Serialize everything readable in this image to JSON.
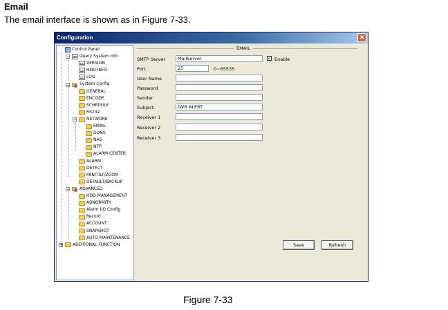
{
  "doc": {
    "heading": "Email",
    "intro": "The email interface is shown as in Figure 7-33.",
    "caption": "Figure 7-33"
  },
  "window": {
    "title": "Configuration",
    "close_glyph": "✕"
  },
  "tree": [
    {
      "label": "Control Panel",
      "icon": "panel-icon"
    },
    {
      "label": "Query System Info",
      "icon": "doc-icon"
    },
    {
      "label": "VERSION",
      "icon": "doc-icon"
    },
    {
      "label": "HDD INFO",
      "icon": "doc-icon"
    },
    {
      "label": "LOG",
      "icon": "doc-icon"
    },
    {
      "label": "System Config",
      "icon": "gear-icon"
    },
    {
      "label": "GENERAL",
      "icon": "folder-icon"
    },
    {
      "label": "ENCODE",
      "icon": "folder-icon"
    },
    {
      "label": "SCHEDULE",
      "icon": "folder-icon"
    },
    {
      "label": "RS232",
      "icon": "folder-icon"
    },
    {
      "label": "NETWORK",
      "icon": "folder-icon"
    },
    {
      "label": "EMAIL",
      "icon": "folder-icon"
    },
    {
      "label": "DDNS",
      "icon": "folder-icon"
    },
    {
      "label": "NAS",
      "icon": "folder-icon"
    },
    {
      "label": "NTP",
      "icon": "folder-icon"
    },
    {
      "label": "ALARM CENTER",
      "icon": "folder-icon"
    },
    {
      "label": "ALARM",
      "icon": "folder-icon"
    },
    {
      "label": "DETECT",
      "icon": "folder-icon"
    },
    {
      "label": "PAN/TILT/ZOOM",
      "icon": "folder-icon"
    },
    {
      "label": "DEFAULT/BACKUP",
      "icon": "folder-icon"
    },
    {
      "label": "ADVANCED",
      "icon": "gear-icon"
    },
    {
      "label": "HDD MANAGEMENT",
      "icon": "folder-icon"
    },
    {
      "label": "ABNORMITY",
      "icon": "folder-icon"
    },
    {
      "label": "Alarm I/O Config",
      "icon": "folder-icon"
    },
    {
      "label": "Record",
      "icon": "folder-icon"
    },
    {
      "label": "ACCOUNT",
      "icon": "folder-icon"
    },
    {
      "label": "SNAPSHOT",
      "icon": "folder-icon"
    },
    {
      "label": "AUTO MAINTENANCE",
      "icon": "folder-icon"
    },
    {
      "label": "ADDTIONAL FUNCTION",
      "icon": "folder-icon"
    }
  ],
  "form": {
    "group_title": "EMAIL",
    "smtp_server_label": "SMTP Server",
    "smtp_server_value": "MailServer",
    "enable_label": "Enable",
    "enable_checked": "✓",
    "port_label": "Port",
    "port_value": "25",
    "port_range": "0~65535",
    "user_name_label": "User Name",
    "user_name_value": "",
    "password_label": "Password",
    "password_value": "",
    "sender_label": "Sender",
    "sender_value": "",
    "subject_label": "Subject",
    "subject_value": "DVR ALERT",
    "receiver1_label": "Receiver 1",
    "receiver1_value": "",
    "receiver2_label": "Receiver 2",
    "receiver2_value": "",
    "receiver3_label": "Receiver 3",
    "receiver3_value": ""
  },
  "buttons": {
    "save": "Save",
    "refresh": "Refresh"
  }
}
